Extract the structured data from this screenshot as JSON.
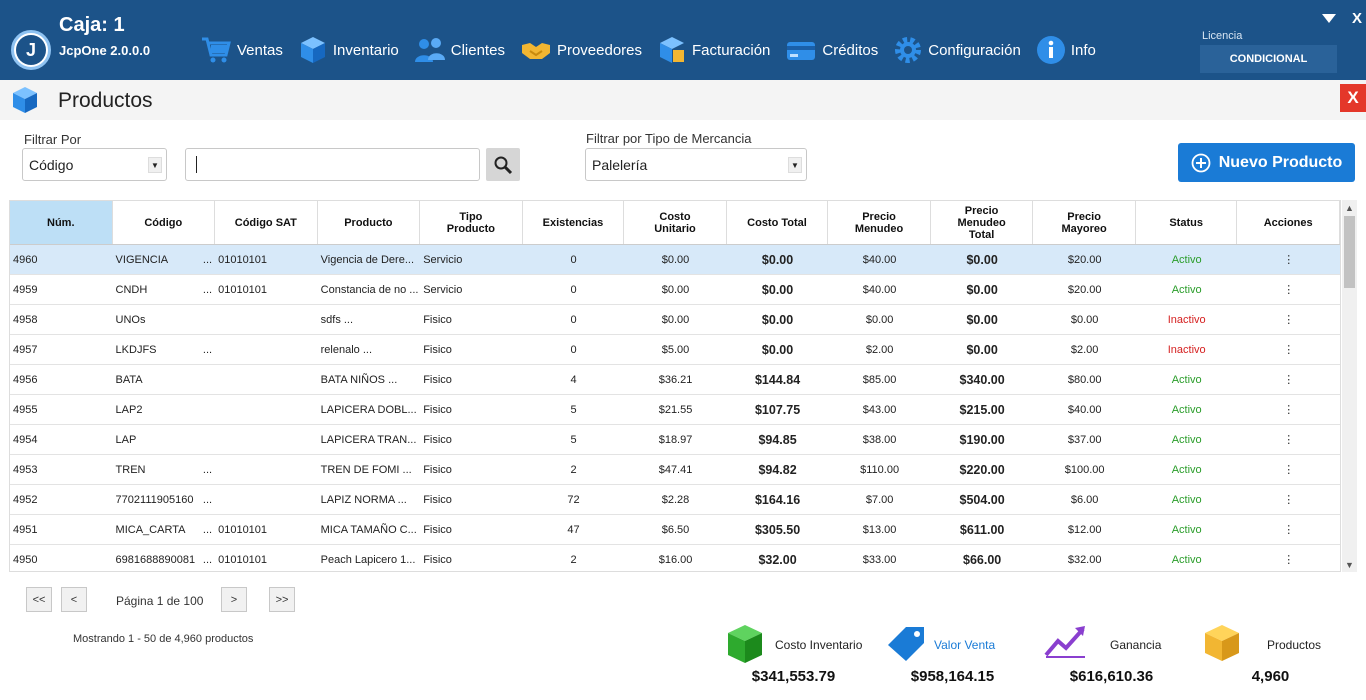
{
  "app": {
    "caja": "Caja: 1",
    "version": "JcpOne 2.0.0.0",
    "logo_letter": "J"
  },
  "nav": [
    {
      "label": "Ventas",
      "icon": "cart-icon"
    },
    {
      "label": "Inventario",
      "icon": "cube-icon"
    },
    {
      "label": "Clientes",
      "icon": "users-icon"
    },
    {
      "label": "Proveedores",
      "icon": "handshake-icon"
    },
    {
      "label": "Facturación",
      "icon": "invoice-icon"
    },
    {
      "label": "Créditos",
      "icon": "credit-card-icon"
    },
    {
      "label": "Configuración",
      "icon": "gear-icon"
    },
    {
      "label": "Info",
      "icon": "info-icon"
    }
  ],
  "licencia": {
    "label": "Licencia",
    "value": "CONDICIONAL"
  },
  "window": {
    "close": "X"
  },
  "page": {
    "title": "Productos",
    "close": "X"
  },
  "filters": {
    "filtrar_por_label": "Filtrar Por",
    "filtrar_por_value": "Código",
    "search_value": "",
    "tipo_label": "Filtrar por Tipo de Mercancia",
    "tipo_value": "Palelería",
    "nuevo_label": "Nuevo Producto"
  },
  "table": {
    "columns": [
      "Núm.",
      "Código",
      "Código SAT",
      "Producto",
      "Tipo\nProducto",
      "Existencias",
      "Costo\nUnitario",
      "Costo Total",
      "Precio\nMenudeo",
      "Precio\nMenudeo\nTotal",
      "Precio\nMayoreo",
      "Status",
      "Acciones"
    ],
    "rows": [
      [
        "4960",
        "VIGENCIA",
        "...",
        "01010101",
        "Vigencia de Dere...",
        "Servicio",
        "0",
        "$0.00",
        "$0.00",
        "$40.00",
        "$0.00",
        "$20.00",
        "Activo",
        "⋮"
      ],
      [
        "4959",
        "CNDH",
        "...",
        "01010101",
        "Constancia de no ...",
        "Servicio",
        "0",
        "$0.00",
        "$0.00",
        "$40.00",
        "$0.00",
        "$20.00",
        "Activo",
        "⋮"
      ],
      [
        "4958",
        "UNOs",
        "",
        "",
        "sdfs ...",
        "Fisico",
        "0",
        "$0.00",
        "$0.00",
        "$0.00",
        "$0.00",
        "$0.00",
        "Inactivo",
        "⋮"
      ],
      [
        "4957",
        "LKDJFS",
        "...",
        "",
        "relenalo ...",
        "Fisico",
        "0",
        "$5.00",
        "$0.00",
        "$2.00",
        "$0.00",
        "$2.00",
        "Inactivo",
        "⋮"
      ],
      [
        "4956",
        "BATA",
        "",
        "",
        "BATA NIÑOS ...",
        "Fisico",
        "4",
        "$36.21",
        "$144.84",
        "$85.00",
        "$340.00",
        "$80.00",
        "Activo",
        "⋮"
      ],
      [
        "4955",
        "LAP2",
        "",
        "",
        "LAPICERA DOBL...",
        "Fisico",
        "5",
        "$21.55",
        "$107.75",
        "$43.00",
        "$215.00",
        "$40.00",
        "Activo",
        "⋮"
      ],
      [
        "4954",
        "LAP",
        "",
        "",
        "LAPICERA TRAN...",
        "Fisico",
        "5",
        "$18.97",
        "$94.85",
        "$38.00",
        "$190.00",
        "$37.00",
        "Activo",
        "⋮"
      ],
      [
        "4953",
        "TREN",
        "...",
        "",
        "TREN DE FOMI ...",
        "Fisico",
        "2",
        "$47.41",
        "$94.82",
        "$110.00",
        "$220.00",
        "$100.00",
        "Activo",
        "⋮"
      ],
      [
        "4952",
        "7702111905160",
        "...",
        "",
        "LAPIZ NORMA ...",
        "Fisico",
        "72",
        "$2.28",
        "$164.16",
        "$7.00",
        "$504.00",
        "$6.00",
        "Activo",
        "⋮"
      ],
      [
        "4951",
        "MICA_CARTA",
        "...",
        "01010101",
        "MICA TAMAÑO C...",
        "Fisico",
        "47",
        "$6.50",
        "$305.50",
        "$13.00",
        "$611.00",
        "$12.00",
        "Activo",
        "⋮"
      ],
      [
        "4950",
        "6981688890081",
        "...",
        "01010101",
        "Peach Lapicero 1...",
        "Fisico",
        "2",
        "$16.00",
        "$32.00",
        "$33.00",
        "$66.00",
        "$32.00",
        "Activo",
        "⋮"
      ]
    ]
  },
  "pagination": {
    "first": "<<",
    "prev": "<",
    "next": ">",
    "last": ">>",
    "page_text": "Página 1 de 100",
    "showing": "Mostrando 1 - 50 de 4,960 productos"
  },
  "summary": [
    {
      "label": "Costo Inventario",
      "value": "$341,553.79",
      "icon": "cube-green-icon"
    },
    {
      "label": "Valor Venta",
      "value": "$958,164.15",
      "icon": "price-tag-icon"
    },
    {
      "label": "Ganancia",
      "value": "$616,610.36",
      "icon": "trend-up-icon"
    },
    {
      "label": "Productos",
      "value": "4,960",
      "icon": "box-icon"
    }
  ],
  "colors": {
    "topbar": "#1c5389",
    "accent": "#1a7bd6",
    "active_status": "#2a9d2a",
    "inactive_status": "#d52020",
    "selected_row": "#d7e9f9",
    "close_red": "#e4372a"
  }
}
